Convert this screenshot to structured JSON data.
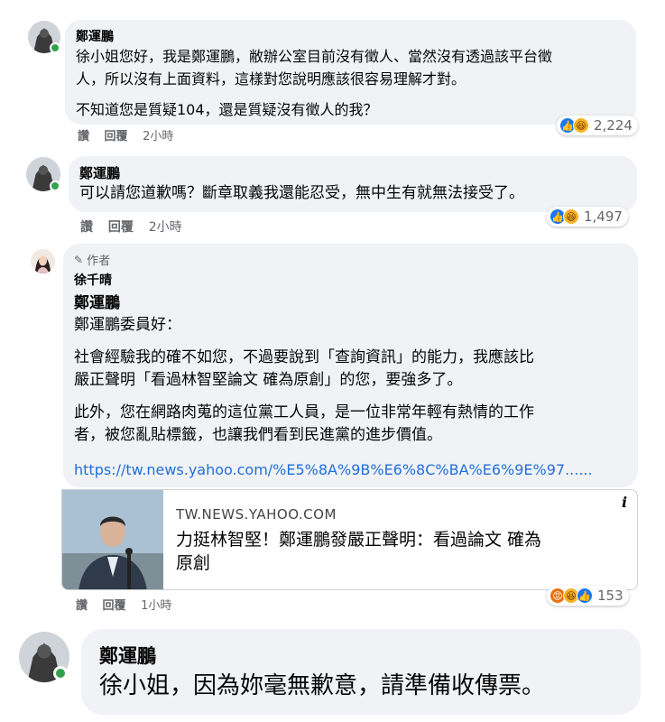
{
  "comments": [
    {
      "author": "鄭運鵬",
      "lines": [
        "徐小姐您好，我是鄭運鵬，敝辦公室目前沒有徵人、當然沒有透過該平台徵",
        "人，所以沒有上面資料，這樣對您說明應該很容易理解才對。"
      ],
      "line2": "不知道您是質疑104，還是質疑沒有徵人的我？",
      "actions": {
        "like": "讚",
        "reply": "回覆",
        "time": "2小時"
      },
      "reactions": {
        "icons": [
          "like-icon",
          "haha-icon"
        ],
        "count": "2,224"
      }
    },
    {
      "author": "鄭運鵬",
      "text": "可以請您道歉嗎？斷章取義我還能忍受，無中生有就無法接受了。",
      "actions": {
        "like": "讚",
        "reply": "回覆",
        "time": "2小時"
      },
      "reactions": {
        "icons": [
          "like-icon",
          "haha-icon"
        ],
        "count": "1,497"
      }
    },
    {
      "author_badge": "作者",
      "author": "徐千晴",
      "mention": "鄭運鵬",
      "greeting": "鄭運鵬委員好：",
      "p1": [
        "社會經驗我的確不如您，不過要說到「查詢資訊」的能力，我應該比",
        "嚴正聲明「看過林智堅論文 確為原創」的您，要強多了。"
      ],
      "p2": [
        "此外，您在網路肉蒐的這位黨工人員，是一位非常年輕有熱情的工作",
        "者，被您亂貼標籤，也讓我們看到民進黨的進步價值。"
      ],
      "link": "https://tw.news.yahoo.com/%E5%8A%9B%E6%8C%BA%E6%9E%97......",
      "card": {
        "domain": "TW.NEWS.YAHOO.COM",
        "title_lines": [
          "力挺林智堅！鄭運鵬發嚴正聲明：看過論文 確為",
          "原創"
        ],
        "info": "i"
      },
      "actions": {
        "like": "讚",
        "reply": "回覆",
        "time": "1小時"
      },
      "reactions": {
        "icons": [
          "angry-icon",
          "haha-icon",
          "like-icon"
        ],
        "count": "153"
      }
    },
    {
      "author": "鄭運鵬",
      "text": "徐小姐，因為妳毫無歉意，請準備收傳票。"
    }
  ],
  "colors": {
    "bubble": "#f0f2f5",
    "link": "#216fdb",
    "online": "#31a24c",
    "like": "#1877f2",
    "haha": "#f7b125",
    "angry": "#e9710f"
  }
}
